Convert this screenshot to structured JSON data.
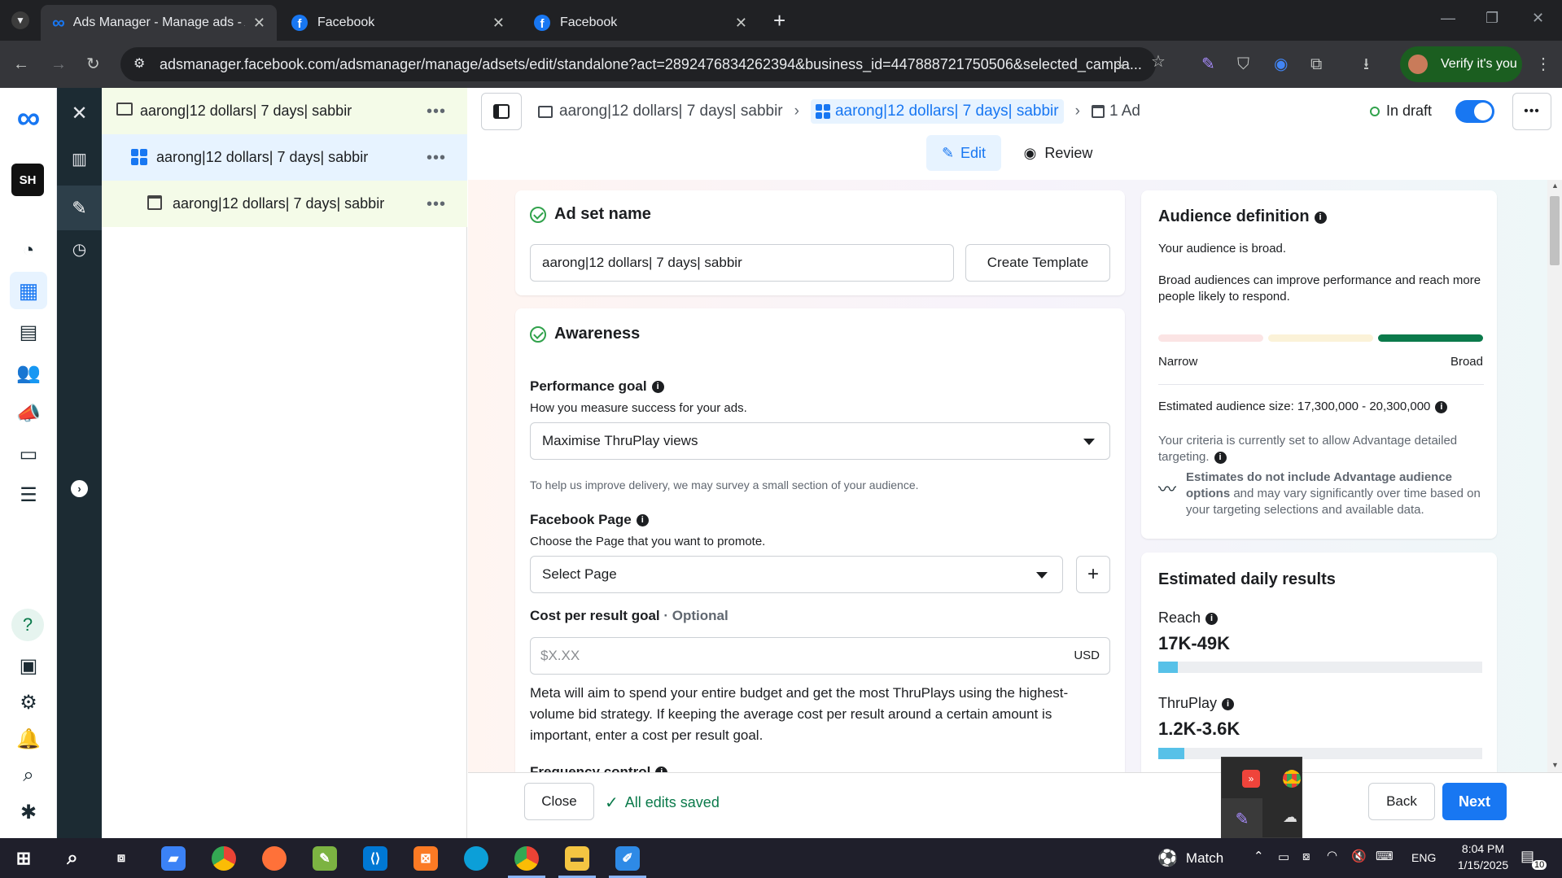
{
  "browser": {
    "tabs": [
      {
        "title": "Ads Manager - Manage ads - A",
        "active": true
      },
      {
        "title": "Facebook",
        "active": false
      },
      {
        "title": "Facebook",
        "active": false
      }
    ],
    "url": "adsmanager.facebook.com/adsmanager/manage/adsets/edit/standalone?act=2892476834262394&business_id=447888721750506&selected_campa...",
    "verify_label": "Verify it's you"
  },
  "rail": {
    "avatar_initials": "SH"
  },
  "tree": {
    "items": [
      {
        "label": "aarong|12 dollars| 7 days| sabbir",
        "level": "campaign"
      },
      {
        "label": "aarong|12 dollars| 7 days| sabbir",
        "level": "adset"
      },
      {
        "label": "aarong|12 dollars| 7 days| sabbir",
        "level": "ad"
      }
    ]
  },
  "breadcrumb": {
    "campaign": "aarong|12 dollars| 7 days| sabbir",
    "adset": "aarong|12 dollars| 7 days| sabbir",
    "ad": "1 Ad",
    "status": "In draft"
  },
  "modes": {
    "edit": "Edit",
    "review": "Review"
  },
  "adset_name": {
    "title": "Ad set name",
    "value": "aarong|12 dollars| 7 days| sabbir",
    "create_template": "Create Template"
  },
  "awareness": {
    "title": "Awareness",
    "performance_goal_label": "Performance goal",
    "performance_goal_help": "How you measure success for your ads.",
    "performance_goal_value": "Maximise ThruPlay views",
    "survey_note": "To help us improve delivery, we may survey a small section of your audience.",
    "page_label": "Facebook Page",
    "page_help": "Choose the Page that you want to promote.",
    "page_value": "Select Page",
    "cost_label": "Cost per result goal",
    "cost_optional": "· Optional",
    "cost_placeholder": "$X.XX",
    "cost_currency": "USD",
    "cost_description": "Meta will aim to spend your entire budget and get the most ThruPlays using the highest-volume bid strategy. If keeping the average cost per result around a certain amount is important, enter a cost per result goal.",
    "frequency_label": "Frequency control"
  },
  "audience": {
    "title": "Audience definition",
    "broad_text": "Your audience is broad.",
    "broad_desc": "Broad audiences can improve performance and reach more people likely to respond.",
    "narrow": "Narrow",
    "broad": "Broad",
    "size_label": "Estimated audience size: 17,300,000 - 20,300,000",
    "criteria": "Your criteria is currently set to allow Advantage detailed targeting.",
    "estimates_bold": "Estimates do not include Advantage audience options",
    "estimates_rest": " and may vary significantly over time based on your targeting selections and available data."
  },
  "daily": {
    "title": "Estimated daily results",
    "reach_label": "Reach",
    "reach_value": "17K-49K",
    "reach_fraction": 0.06,
    "thruplay_label": "ThruPlay",
    "thruplay_value": "1.2K-3.6K",
    "thruplay_fraction": 0.08
  },
  "footer": {
    "close": "Close",
    "saved": "All edits saved",
    "back": "Back",
    "next": "Next"
  },
  "taskbar": {
    "match_label": "Match",
    "lang": "ENG",
    "time": "8:04 PM",
    "date": "1/15/2025",
    "notif_count": "10"
  },
  "colors": {
    "facebook_blue": "#1877f2",
    "selected_bg": "#e7f3ff",
    "green_ok": "#31a24c",
    "broad_bar": "#0b7a4b"
  }
}
